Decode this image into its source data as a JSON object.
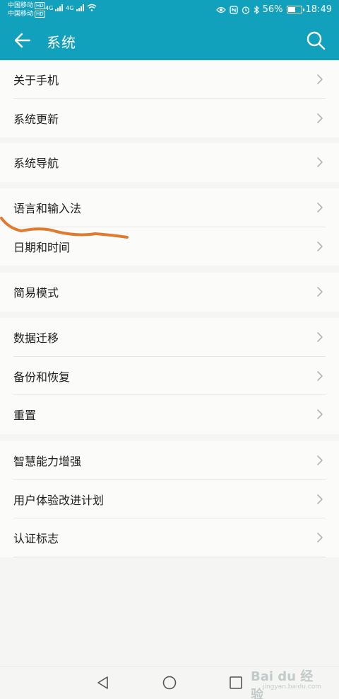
{
  "status_bar": {
    "carrier_1": "中国移动",
    "carrier_2": "中国移动",
    "hd": "HD",
    "network": "4G",
    "battery": "56%",
    "time": "18:49",
    "battery_level": 0.56
  },
  "app_bar": {
    "title": "系统"
  },
  "groups": [
    [
      "关于手机",
      "系统更新"
    ],
    [
      "系统导航"
    ],
    [
      "语言和输入法",
      "日期和时间"
    ],
    [
      "简易模式"
    ],
    [
      "数据迁移",
      "备份和恢复",
      "重置"
    ],
    [
      "智慧能力增强",
      "用户体验改进计划",
      "认证标志"
    ]
  ],
  "watermark": {
    "text": "Bai du 经验",
    "url": "jingyan.baidu.com"
  },
  "colors": {
    "accent": "#11a1bc",
    "annotation": "#e07a2e"
  },
  "icons": [
    "back-arrow-icon",
    "search-icon",
    "chevron-right-icon",
    "nav-back-icon",
    "nav-home-icon",
    "nav-recents-icon"
  ]
}
